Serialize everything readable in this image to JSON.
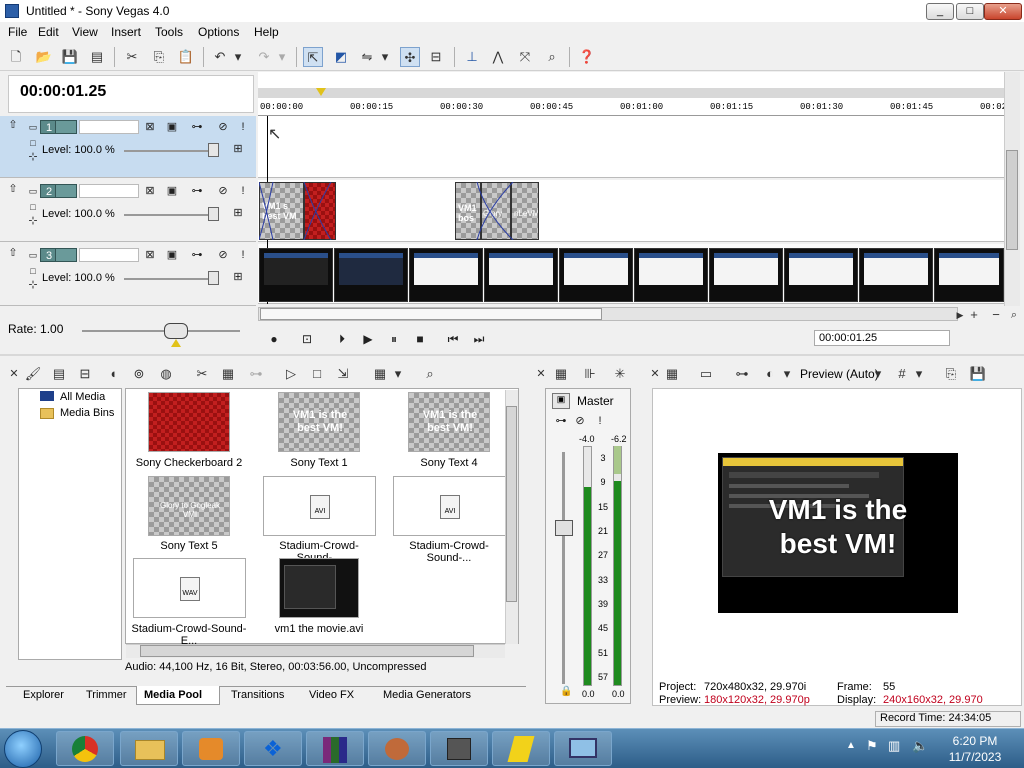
{
  "window": {
    "title": "Untitled * - Sony Vegas 4.0",
    "min": "_",
    "max": "□",
    "close": "✕"
  },
  "menu": [
    "File",
    "Edit",
    "View",
    "Insert",
    "Tools",
    "Options",
    "Help"
  ],
  "timecode": "00:00:01.25",
  "ruler": [
    "00:00:00",
    "00:00:15",
    "00:00:30",
    "00:00:45",
    "00:01:00",
    "00:01:15",
    "00:01:30",
    "00:01:45",
    "00:02"
  ],
  "tracks": [
    {
      "num": "1",
      "level": "Level: 100.0 %"
    },
    {
      "num": "2",
      "level": "Level: 100.0 %"
    },
    {
      "num": "3",
      "level": "Level: 100.0 %"
    }
  ],
  "track2_clips": {
    "a": "VM1 s best VM",
    "b": "VM1 bos",
    "c": "Glory",
    "d": "nLeVM"
  },
  "rate": "Rate: 1.00",
  "transport_time": "00:00:01.25",
  "media_tree": [
    "All Media",
    "Media Bins"
  ],
  "media_items": [
    {
      "label": "Sony Checkerboard 2",
      "kind": "red"
    },
    {
      "label": "Sony Text 1",
      "kind": "text",
      "text": "VM1 is the best VM!"
    },
    {
      "label": "Sony Text 4",
      "kind": "text",
      "text": "VM1 is the best VM!"
    },
    {
      "label": "Sony Text 5",
      "kind": "text",
      "text": "Glory to Gogleak VMI"
    },
    {
      "label": "Stadium-Crowd-Sound-...",
      "kind": "avi",
      "tag": "AVI"
    },
    {
      "label": "Stadium-Crowd-Sound-...",
      "kind": "avi",
      "tag": "AVI"
    },
    {
      "label": "Stadium-Crowd-Sound-E...",
      "kind": "wav",
      "tag": "WAV"
    },
    {
      "label": "vm1 the movie.avi",
      "kind": "movie"
    }
  ],
  "media_status": "Audio: 44,100 Hz, 16 Bit, Stereo, 00:03:56.00, Uncompressed",
  "tabs": [
    "Explorer",
    "Trimmer",
    "Media Pool",
    "Transitions",
    "Video FX",
    "Media Generators"
  ],
  "active_tab": "Media Pool",
  "master": {
    "label": "Master",
    "left_peak": "-4.0",
    "right_peak": "-6.2",
    "scale": [
      "3",
      "9",
      "15",
      "21",
      "27",
      "33",
      "39",
      "45",
      "51",
      "57"
    ],
    "bottom_l": "0.0",
    "bottom_r": "0.0"
  },
  "preview": {
    "mode": "Preview (Auto)",
    "overlay": [
      "VM1 is the",
      "best VM!"
    ],
    "project_label": "Project:",
    "project_value": "720x480x32, 29.970i",
    "preview_label": "Preview:",
    "preview_value": "180x120x32, 29.970p",
    "frame_label": "Frame:",
    "frame_value": "55",
    "display_label": "Display:",
    "display_value": "240x160x32, 29.970"
  },
  "record_time": "Record Time: 24:34:05",
  "clock": {
    "time": "6:20 PM",
    "date": "11/7/2023"
  },
  "colors": {
    "accent_red": "#c21f1f",
    "track_teal": "#5b8a8a",
    "selected_track": "#c7dcf0",
    "preview_red": "#c0001c"
  }
}
